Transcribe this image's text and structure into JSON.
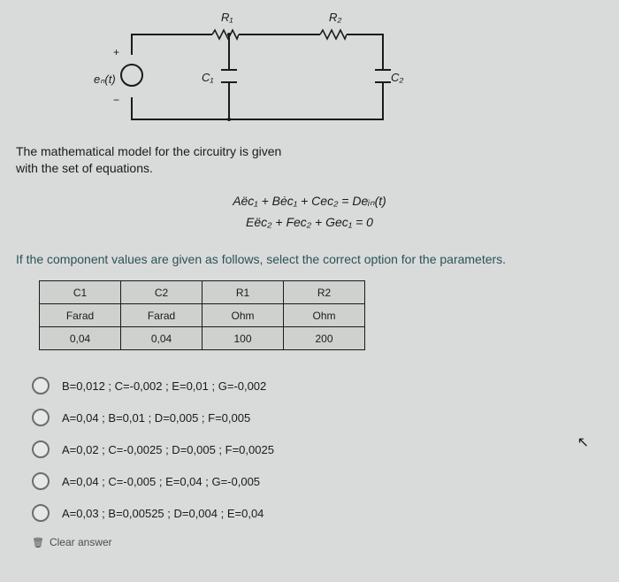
{
  "circuit": {
    "source_label": "eₙ(t)",
    "r1_label": "R₁",
    "r2_label": "R₂",
    "c1_label": "C₁",
    "c2_label": "C₂",
    "plus": "+",
    "minus": "−"
  },
  "text": {
    "model_intro_1": "The mathematical model for the circuitry is given",
    "model_intro_2": "with the set of equations.",
    "eq1": "Aëc₁ + Bėc₁ + Cec₂ = Deᵢₙ(t)",
    "eq2": "Eëc₂ + Fec₂ + Gec₁ = 0",
    "instruction": "If the component values are given as follows, select the correct option for the parameters.",
    "clear": "Clear answer"
  },
  "table": {
    "headers": [
      "C1",
      "C2",
      "R1",
      "R2"
    ],
    "units": [
      "Farad",
      "Farad",
      "Ohm",
      "Ohm"
    ],
    "values": [
      "0,04",
      "0,04",
      "100",
      "200"
    ]
  },
  "options": [
    "B=0,012 ; C=-0,002 ; E=0,01 ; G=-0,002",
    "A=0,04 ; B=0,01 ; D=0,005 ; F=0,005",
    "A=0,02 ; C=-0,0025 ; D=0,005 ; F=0,0025",
    "A=0,04 ; C=-0,005 ; E=0,04 ; G=-0,005",
    "A=0,03 ; B=0,00525 ; D=0,004 ; E=0,04"
  ]
}
